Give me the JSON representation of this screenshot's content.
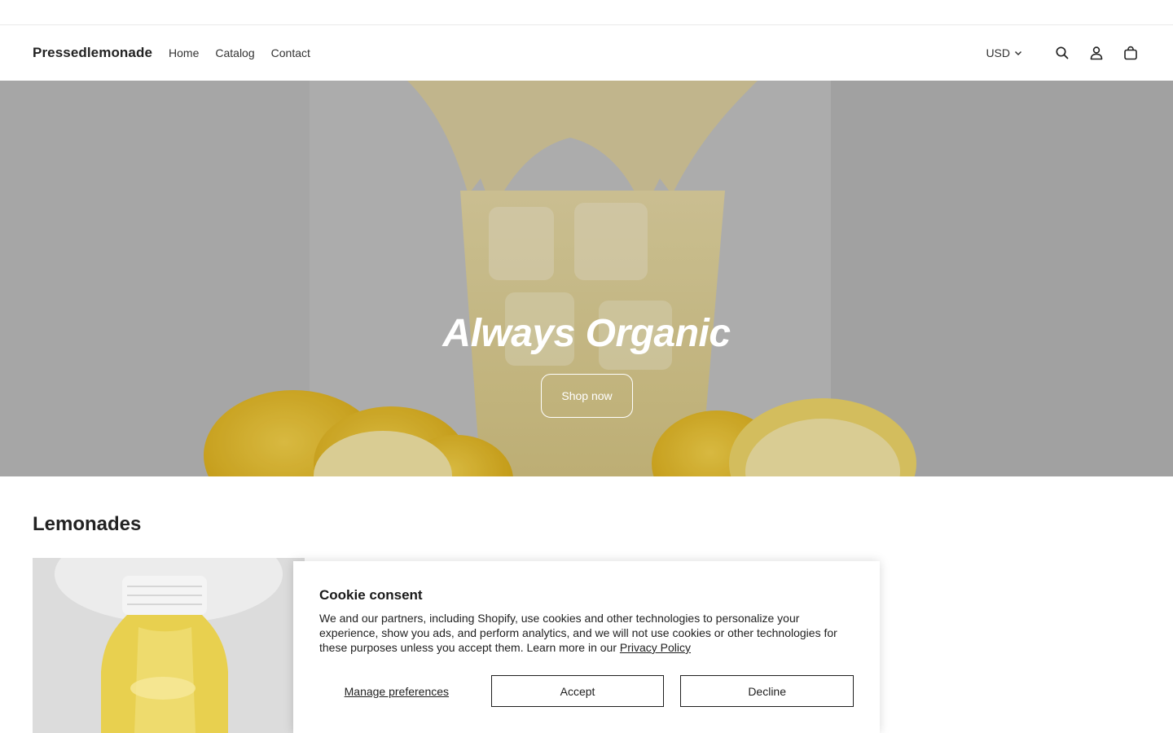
{
  "header": {
    "brand": "Pressedlemonade",
    "nav": [
      {
        "label": "Home"
      },
      {
        "label": "Catalog"
      },
      {
        "label": "Contact"
      }
    ],
    "currency": "USD",
    "icons": [
      "search-icon",
      "account-icon",
      "cart-icon"
    ]
  },
  "hero": {
    "title": "Always Organic",
    "button": "Shop now"
  },
  "collection": {
    "title": "Lemonades"
  },
  "cookie": {
    "title": "Cookie consent",
    "text": "We and our partners, including Shopify, use cookies and other technologies to personalize your experience, show you ads, and perform analytics, and we will not use cookies or other technologies for these purposes unless you accept them. Learn more in our ",
    "privacy_link": "Privacy Policy",
    "manage": "Manage preferences",
    "accept": "Accept",
    "decline": "Decline"
  },
  "colors": {
    "text": "#1f1f1f",
    "hero_overlay_text": "#ffffff",
    "lemon": "#f2c21b"
  }
}
